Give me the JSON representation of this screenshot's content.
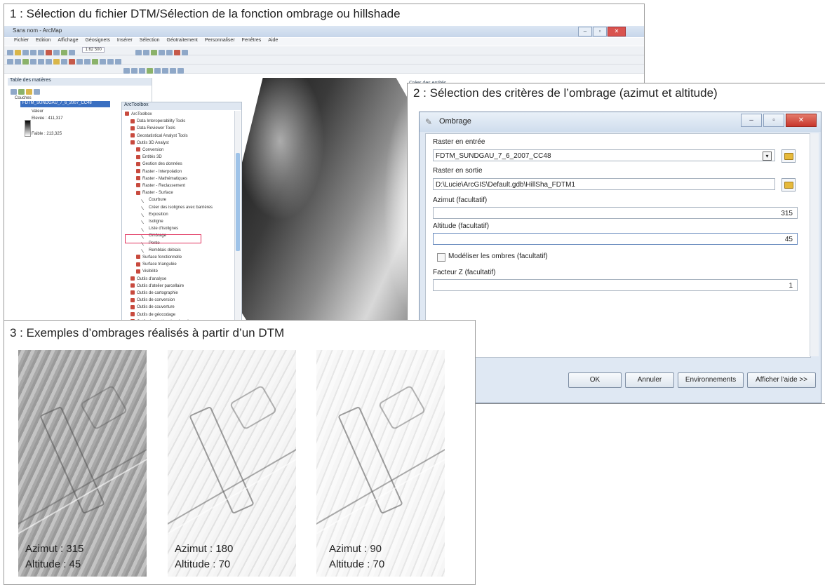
{
  "panel1": {
    "caption": "1 : Sélection du fichier DTM/Sélection de la fonction ombrage ou hillshade",
    "window_title": "Sans nom - ArcMap",
    "menu": [
      "Fichier",
      "Edition",
      "Affichage",
      "Géosignets",
      "Insérer",
      "Sélection",
      "Géotraitement",
      "Personnaliser",
      "Fenêtres",
      "Aide"
    ],
    "scale": "1:62 500",
    "toc": {
      "header": "Table des matières",
      "group": "Couches",
      "layer": "FDTM_SUNDGAU_7_6_2007_CC48",
      "value_label": "Valeur",
      "high": "Elevée : 411,317",
      "low": "Faible : 213,325"
    },
    "toolbox": {
      "header": "ArcToolbox",
      "items": [
        "ArcToolbox",
        "Data Interoperability Tools",
        "Data Reviewer Tools",
        "Geostatistical Analyst Tools",
        "Outils 3D Analyst",
        "Conversion",
        "Entités 3D",
        "Gestion des données",
        "Raster - Interpolation",
        "Raster - Mathématiques",
        "Raster - Reclassement",
        "Raster - Surface",
        "Courbure",
        "Créer des isolignes avec barrières",
        "Exposition",
        "Isoligne",
        "Liste d'isolignes",
        "Ombrage",
        "Pente",
        "Remblais déblais",
        "Surface fonctionnelle",
        "Surface triangulée",
        "Visibilité",
        "Outils d'analyse",
        "Outils d'atelier parcellaire",
        "Outils de cartographie",
        "Outils de conversion",
        "Outils de couverture",
        "Outils de géocodage",
        "Outils de gestion des données"
      ]
    },
    "map_panel_label": "Créer des entités"
  },
  "panel2": {
    "caption": "2 : Sélection des critères de l’ombrage (azimut et altitude)",
    "dialog_title": "Ombrage",
    "raster_in_label": "Raster en entrée",
    "raster_in_value": "FDTM_SUNDGAU_7_6_2007_CC48",
    "raster_out_label": "Raster en sortie",
    "raster_out_value": "D:\\Lucie\\ArcGIS\\Default.gdb\\HillSha_FDTM1",
    "azimut_label": "Azimut (facultatif)",
    "azimut_value": "315",
    "altitude_label": "Altitude (facultatif)",
    "altitude_value": "45",
    "shadows_label": "Modéliser les ombres (facultatif)",
    "zfactor_label": "Facteur Z (facultatif)",
    "zfactor_value": "1",
    "buttons": {
      "ok": "OK",
      "cancel": "Annuler",
      "env": "Environnements",
      "help": "Afficher l'aide >>"
    }
  },
  "panel3": {
    "caption": "3 : Exemples d’ombrages réalisés à partir d’un DTM",
    "examples": [
      {
        "azimut": "Azimut : 315",
        "altitude": "Altitude : 45"
      },
      {
        "azimut": "Azimut : 180",
        "altitude": "Altitude : 70"
      },
      {
        "azimut": "Azimut : 90",
        "altitude": "Altitude : 70"
      }
    ]
  }
}
